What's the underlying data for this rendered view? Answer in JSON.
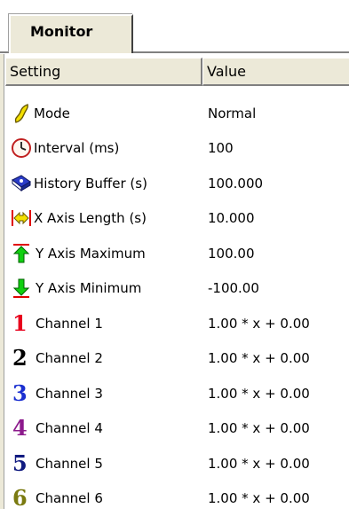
{
  "tab": {
    "label": "Monitor"
  },
  "columns": {
    "setting": "Setting",
    "value": "Value"
  },
  "rows": [
    {
      "label": "Mode",
      "value": "Normal",
      "icon": "mode-icon"
    },
    {
      "label": "Interval (ms)",
      "value": "100",
      "icon": "clock-icon"
    },
    {
      "label": "History Buffer (s)",
      "value": "100.000",
      "icon": "book-icon"
    },
    {
      "label": "X Axis Length (s)",
      "value": "10.000",
      "icon": "x-axis-arrows-icon"
    },
    {
      "label": "Y Axis Maximum",
      "value": "100.00",
      "icon": "up-arrow-icon"
    },
    {
      "label": "Y Axis Minimum",
      "value": "-100.00",
      "icon": "down-arrow-icon"
    }
  ],
  "channels": [
    {
      "digit": "1",
      "label": "Channel 1",
      "value": "1.00 * x + 0.00",
      "color": "#e8001c"
    },
    {
      "digit": "2",
      "label": "Channel 2",
      "value": "1.00 * x + 0.00",
      "color": "#000000"
    },
    {
      "digit": "3",
      "label": "Channel 3",
      "value": "1.00 * x + 0.00",
      "color": "#1a2fd0"
    },
    {
      "digit": "4",
      "label": "Channel 4",
      "value": "1.00 * x + 0.00",
      "color": "#8c1a8c"
    },
    {
      "digit": "5",
      "label": "Channel 5",
      "value": "1.00 * x + 0.00",
      "color": "#101a80"
    },
    {
      "digit": "6",
      "label": "Channel 6",
      "value": "1.00 * x + 0.00",
      "color": "#7a7a10"
    }
  ]
}
